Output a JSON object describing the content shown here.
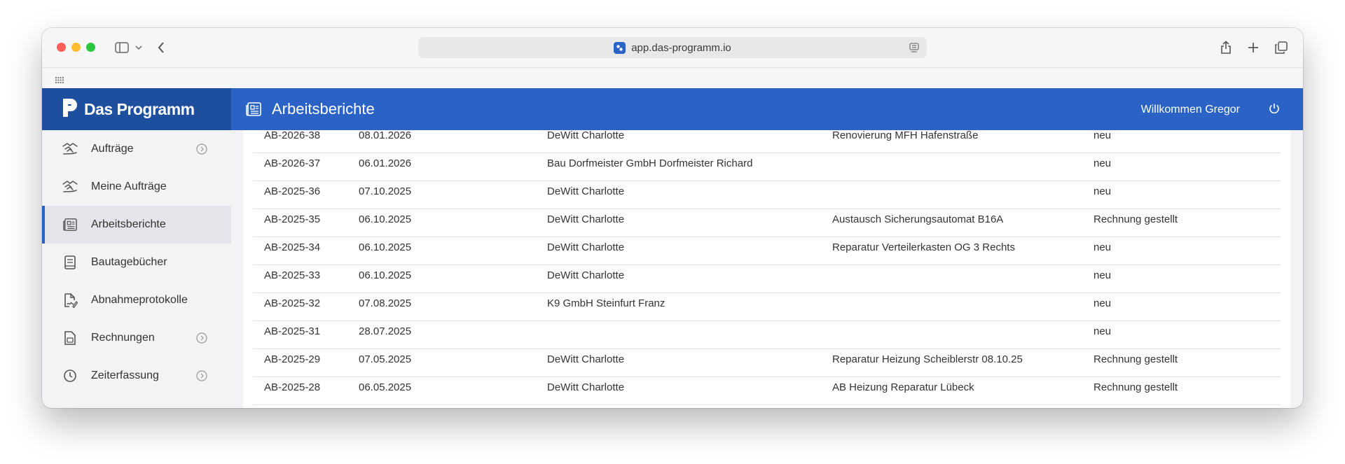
{
  "browser": {
    "url": "app.das-programm.io"
  },
  "app": {
    "logo": "Das Programm",
    "header_title": "Arbeitsberichte",
    "welcome": "Willkommen Gregor"
  },
  "sidebar": {
    "items": [
      {
        "label": "Aufträge",
        "icon": "handshake-icon",
        "has_chevron": true
      },
      {
        "label": "Meine Aufträge",
        "icon": "handshake-icon",
        "has_chevron": false
      },
      {
        "label": "Arbeitsberichte",
        "icon": "newspaper-icon",
        "has_chevron": false,
        "active": true
      },
      {
        "label": "Bautagebücher",
        "icon": "book-icon",
        "has_chevron": false
      },
      {
        "label": "Abnahmeprotokolle",
        "icon": "signed-document-icon",
        "has_chevron": false
      },
      {
        "label": "Rechnungen",
        "icon": "invoice-icon",
        "has_chevron": true
      },
      {
        "label": "Zeiterfassung",
        "icon": "clock-icon",
        "has_chevron": true
      }
    ]
  },
  "table": {
    "rows": [
      {
        "id": "AB-2026-38",
        "date": "08.01.2026",
        "customer": "DeWitt Charlotte",
        "project": "Renovierung MFH Hafenstraße",
        "status": "neu"
      },
      {
        "id": "AB-2026-37",
        "date": "06.01.2026",
        "customer": "Bau Dorfmeister GmbH Dorfmeister Richard",
        "project": "",
        "status": "neu"
      },
      {
        "id": "AB-2025-36",
        "date": "07.10.2025",
        "customer": "DeWitt Charlotte",
        "project": "",
        "status": "neu"
      },
      {
        "id": "AB-2025-35",
        "date": "06.10.2025",
        "customer": "DeWitt Charlotte",
        "project": "Austausch Sicherungsautomat B16A",
        "status": "Rechnung gestellt"
      },
      {
        "id": "AB-2025-34",
        "date": "06.10.2025",
        "customer": "DeWitt Charlotte",
        "project": "Reparatur Verteilerkasten OG 3 Rechts",
        "status": "neu"
      },
      {
        "id": "AB-2025-33",
        "date": "06.10.2025",
        "customer": "DeWitt Charlotte",
        "project": "",
        "status": "neu"
      },
      {
        "id": "AB-2025-32",
        "date": "07.08.2025",
        "customer": "K9 GmbH Steinfurt Franz",
        "project": "",
        "status": "neu"
      },
      {
        "id": "AB-2025-31",
        "date": "28.07.2025",
        "customer": "",
        "project": "",
        "status": "neu"
      },
      {
        "id": "AB-2025-29",
        "date": "07.05.2025",
        "customer": "DeWitt Charlotte",
        "project": "Reparatur Heizung Scheiblerstr 08.10.25",
        "status": "Rechnung gestellt"
      },
      {
        "id": "AB-2025-28",
        "date": "06.05.2025",
        "customer": "DeWitt Charlotte",
        "project": "AB Heizung Reparatur Lübeck",
        "status": "Rechnung gestellt"
      }
    ]
  },
  "colors": {
    "header_blue": "#2a63c5",
    "logo_blue": "#1e4f9e",
    "active_indicator": "#2a63c5"
  }
}
